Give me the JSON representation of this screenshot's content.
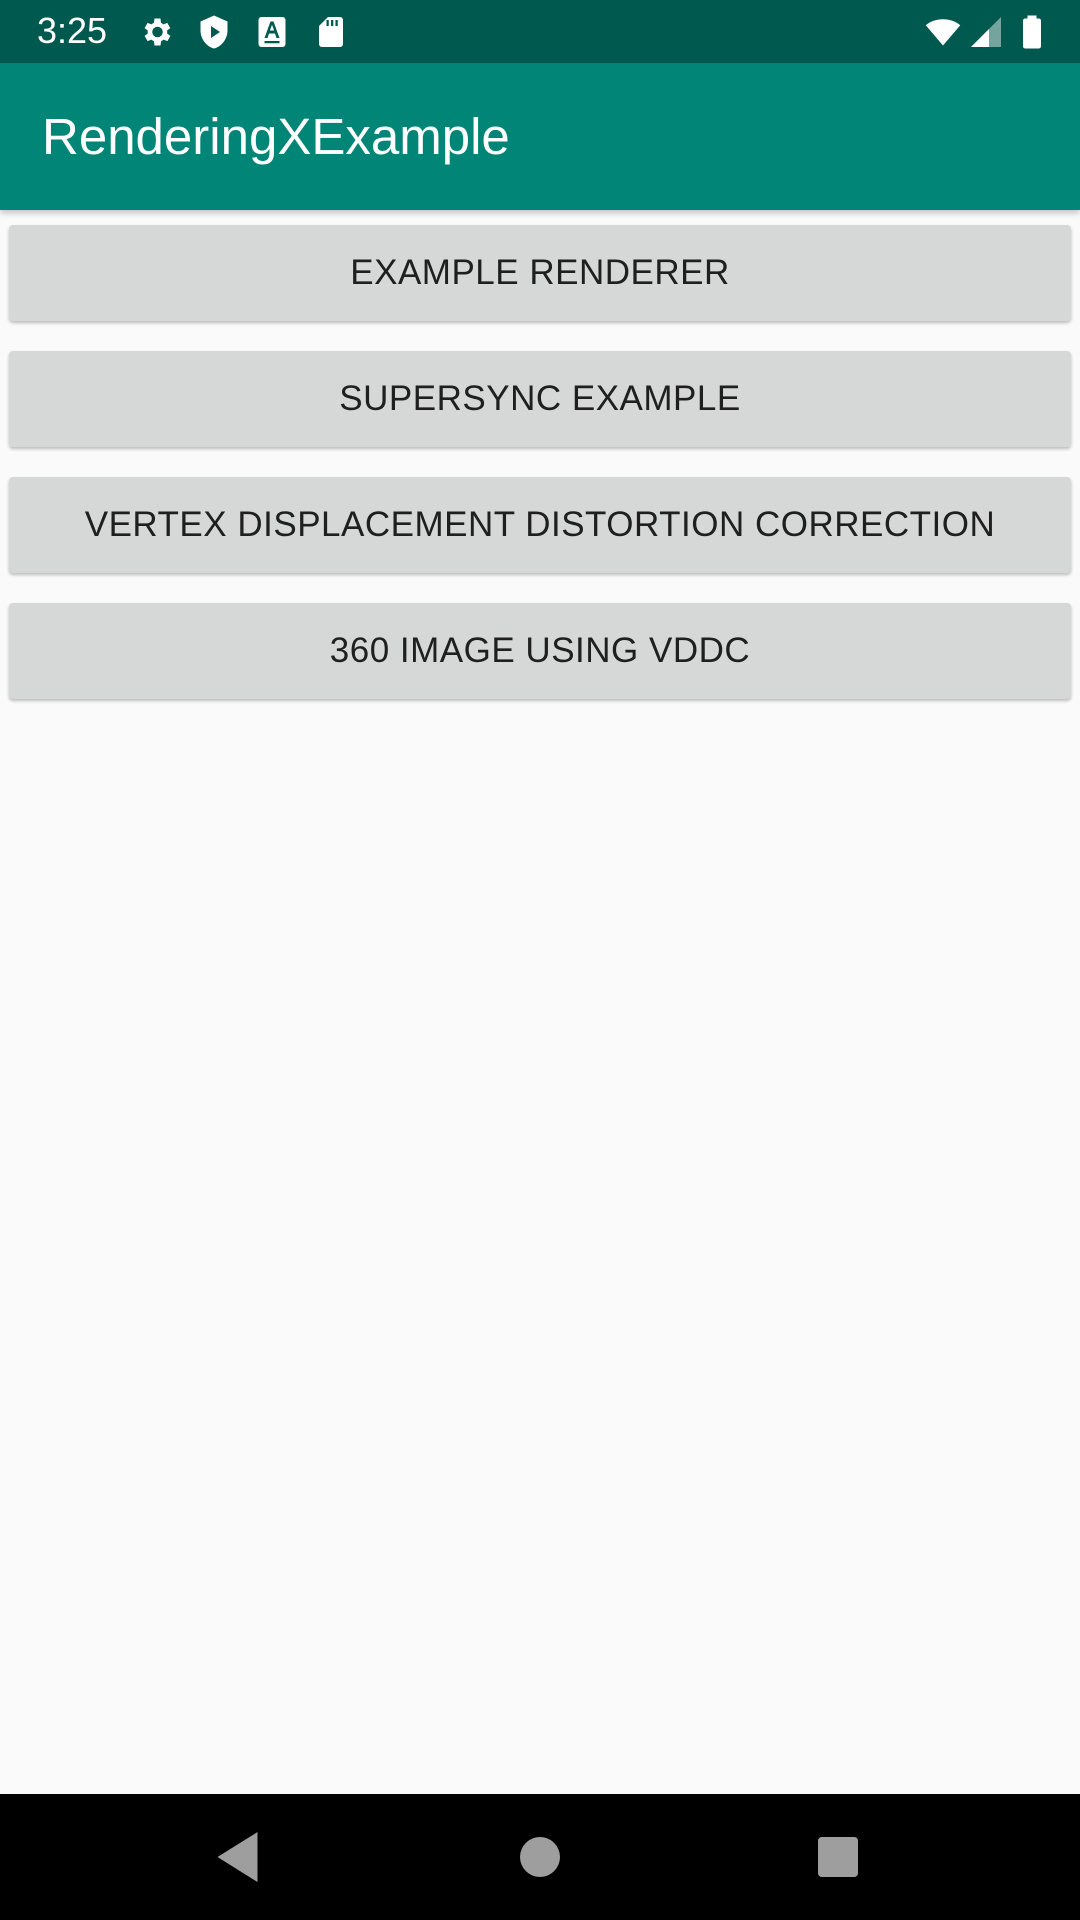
{
  "status_bar": {
    "time": "3:25",
    "icons_left": [
      "gear-icon",
      "play-protect-icon",
      "text-a-icon",
      "sd-card-icon"
    ],
    "icons_right": [
      "wifi-icon",
      "signal-icon",
      "battery-icon"
    ],
    "background": "#00594f"
  },
  "app_bar": {
    "title": "RenderingXExample",
    "background": "#008577"
  },
  "buttons": [
    {
      "label": "EXAMPLE RENDERER"
    },
    {
      "label": "SUPERSYNC EXAMPLE"
    },
    {
      "label": "VERTEX DISPLACEMENT DISTORTION CORRECTION"
    },
    {
      "label": "360 IMAGE USING VDDC"
    }
  ],
  "nav_bar": {
    "items": [
      "back-icon",
      "home-icon",
      "recents-icon"
    ]
  }
}
